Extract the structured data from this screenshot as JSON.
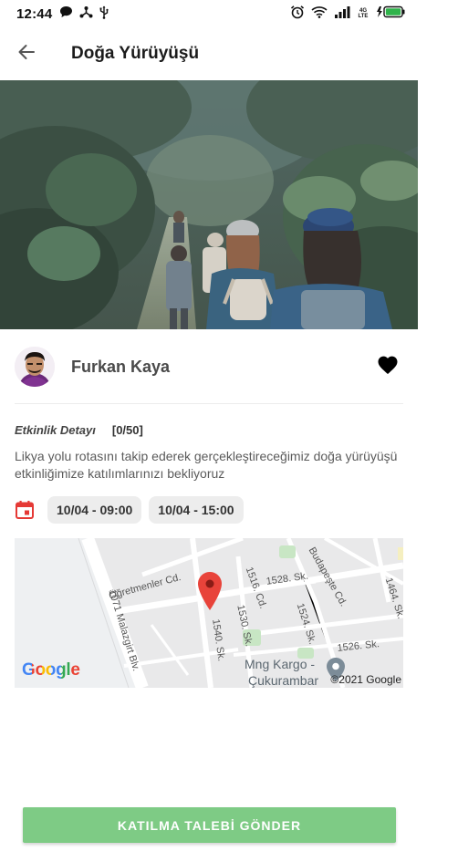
{
  "status_bar": {
    "time": "12:44",
    "network_label": "4G LTE"
  },
  "app_bar": {
    "title": "Doğa Yürüyüşü"
  },
  "organizer": {
    "name": "Furkan Kaya"
  },
  "event": {
    "details_label": "Etkinlik Detayı",
    "participant_count": "[0/50]",
    "description": "Likya yolu rotasını takip ederek gerçekleştireceğimiz doğa yürüyüşü etkinliğimize katılımlarınızı bekliyoruz",
    "start_datetime": "10/04 - 09:00",
    "end_datetime": "10/04 - 15:00"
  },
  "map": {
    "streets": [
      "Öğretmenler Cd.",
      "1516. Cd.",
      "1528. Sk.",
      "Budapeşte Cd.",
      "1464. Sk.",
      "1530. Sk.",
      "1524. Sk.",
      "1540. Sk.",
      "1071 Malazgirt Blv.",
      "1526. Sk."
    ],
    "place_label_line1": "Mng Kargo -",
    "place_label_line2": "Çukurambar",
    "logo": "Google",
    "copyright": "©2021 Google"
  },
  "action": {
    "join_label": "KATILMA TALEBİ GÖNDER"
  },
  "colors": {
    "accent_red": "#e53935",
    "button_green": "#7ecb85",
    "map_pin": "#e8433a"
  },
  "icons": [
    "chat-bubble-icon",
    "usb-hub-icon",
    "usb-icon",
    "alarm-clock-icon",
    "wifi-icon",
    "signal-icon",
    "battery-charging-icon",
    "back-arrow-icon",
    "heart-icon",
    "calendar-icon",
    "map-pin-icon",
    "place-marker-icon"
  ]
}
